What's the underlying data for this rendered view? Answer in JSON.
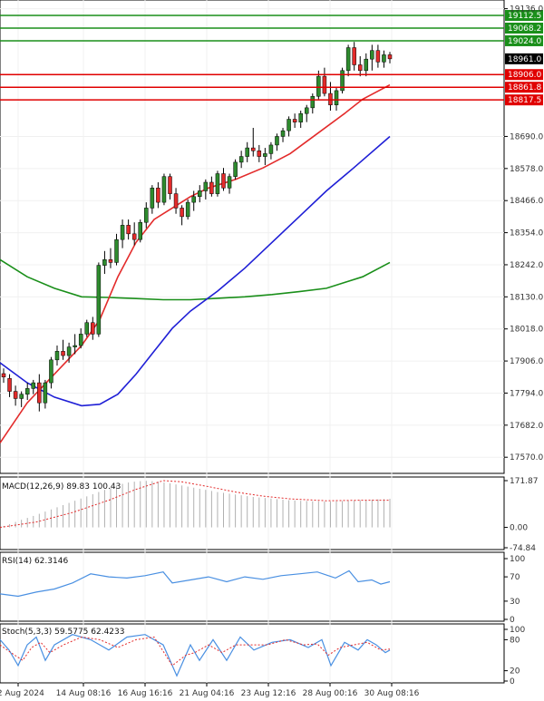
{
  "chart_data": {
    "type": "candlestick",
    "main": {
      "ylim": [
        17520,
        19160
      ],
      "y_ticks": [
        "19136.0",
        "18690.0",
        "18578.0",
        "18466.0",
        "18354.0",
        "18242.0",
        "18130.0",
        "18018.0",
        "17906.0",
        "17794.0",
        "17682.0",
        "17570.0"
      ],
      "current_price": "18961.0",
      "resistance": [
        "19112.5",
        "19068.2",
        "19024.0"
      ],
      "support": [
        "18906.0",
        "18861.8",
        "18817.5"
      ],
      "colors": {
        "up": "#2e8b2e",
        "down": "#e32b2b",
        "resistance": "#1a8f1a",
        "support": "#e00000",
        "ma_fast": "#e32b2b",
        "ma_mid": "#1f1fd6",
        "ma_slow": "#1a8f1a",
        "current": "#000000"
      },
      "candles": [
        {
          "o": 17862,
          "h": 17880,
          "l": 17830,
          "c": 17850
        },
        {
          "o": 17845,
          "h": 17860,
          "l": 17780,
          "c": 17800
        },
        {
          "o": 17800,
          "h": 17820,
          "l": 17750,
          "c": 17775
        },
        {
          "o": 17775,
          "h": 17800,
          "l": 17745,
          "c": 17790
        },
        {
          "o": 17790,
          "h": 17830,
          "l": 17770,
          "c": 17810
        },
        {
          "o": 17810,
          "h": 17840,
          "l": 17790,
          "c": 17830
        },
        {
          "o": 17830,
          "h": 17860,
          "l": 17730,
          "c": 17760
        },
        {
          "o": 17760,
          "h": 17840,
          "l": 17740,
          "c": 17830
        },
        {
          "o": 17830,
          "h": 17920,
          "l": 17810,
          "c": 17910
        },
        {
          "o": 17910,
          "h": 17960,
          "l": 17890,
          "c": 17940
        },
        {
          "o": 17940,
          "h": 17980,
          "l": 17910,
          "c": 17925
        },
        {
          "o": 17925,
          "h": 17970,
          "l": 17900,
          "c": 17955
        },
        {
          "o": 17955,
          "h": 18000,
          "l": 17930,
          "c": 17960
        },
        {
          "o": 17960,
          "h": 18020,
          "l": 17950,
          "c": 18000
        },
        {
          "o": 18000,
          "h": 18050,
          "l": 17990,
          "c": 18040
        },
        {
          "o": 18040,
          "h": 18060,
          "l": 17980,
          "c": 18000
        },
        {
          "o": 18000,
          "h": 18250,
          "l": 17990,
          "c": 18240
        },
        {
          "o": 18240,
          "h": 18290,
          "l": 18210,
          "c": 18260
        },
        {
          "o": 18260,
          "h": 18300,
          "l": 18230,
          "c": 18250
        },
        {
          "o": 18250,
          "h": 18350,
          "l": 18240,
          "c": 18330
        },
        {
          "o": 18330,
          "h": 18400,
          "l": 18300,
          "c": 18380
        },
        {
          "o": 18380,
          "h": 18400,
          "l": 18330,
          "c": 18350
        },
        {
          "o": 18350,
          "h": 18390,
          "l": 18310,
          "c": 18330
        },
        {
          "o": 18330,
          "h": 18400,
          "l": 18320,
          "c": 18390
        },
        {
          "o": 18390,
          "h": 18460,
          "l": 18370,
          "c": 18440
        },
        {
          "o": 18440,
          "h": 18520,
          "l": 18420,
          "c": 18510
        },
        {
          "o": 18510,
          "h": 18530,
          "l": 18440,
          "c": 18460
        },
        {
          "o": 18460,
          "h": 18560,
          "l": 18450,
          "c": 18550
        },
        {
          "o": 18550,
          "h": 18560,
          "l": 18470,
          "c": 18490
        },
        {
          "o": 18490,
          "h": 18510,
          "l": 18420,
          "c": 18440
        },
        {
          "o": 18440,
          "h": 18450,
          "l": 18380,
          "c": 18410
        },
        {
          "o": 18410,
          "h": 18470,
          "l": 18400,
          "c": 18460
        },
        {
          "o": 18460,
          "h": 18500,
          "l": 18430,
          "c": 18480
        },
        {
          "o": 18480,
          "h": 18520,
          "l": 18460,
          "c": 18500
        },
        {
          "o": 18500,
          "h": 18540,
          "l": 18470,
          "c": 18530
        },
        {
          "o": 18530,
          "h": 18550,
          "l": 18480,
          "c": 18490
        },
        {
          "o": 18490,
          "h": 18570,
          "l": 18480,
          "c": 18560
        },
        {
          "o": 18560,
          "h": 18580,
          "l": 18500,
          "c": 18510
        },
        {
          "o": 18510,
          "h": 18560,
          "l": 18490,
          "c": 18550
        },
        {
          "o": 18550,
          "h": 18610,
          "l": 18540,
          "c": 18600
        },
        {
          "o": 18600,
          "h": 18640,
          "l": 18580,
          "c": 18620
        },
        {
          "o": 18620,
          "h": 18670,
          "l": 18600,
          "c": 18650
        },
        {
          "o": 18650,
          "h": 18720,
          "l": 18620,
          "c": 18640
        },
        {
          "o": 18640,
          "h": 18660,
          "l": 18600,
          "c": 18620
        },
        {
          "o": 18620,
          "h": 18650,
          "l": 18590,
          "c": 18630
        },
        {
          "o": 18630,
          "h": 18670,
          "l": 18610,
          "c": 18660
        },
        {
          "o": 18660,
          "h": 18700,
          "l": 18640,
          "c": 18690
        },
        {
          "o": 18690,
          "h": 18720,
          "l": 18670,
          "c": 18710
        },
        {
          "o": 18710,
          "h": 18760,
          "l": 18690,
          "c": 18750
        },
        {
          "o": 18750,
          "h": 18770,
          "l": 18720,
          "c": 18740
        },
        {
          "o": 18740,
          "h": 18780,
          "l": 18720,
          "c": 18770
        },
        {
          "o": 18770,
          "h": 18800,
          "l": 18740,
          "c": 18790
        },
        {
          "o": 18790,
          "h": 18840,
          "l": 18770,
          "c": 18830
        },
        {
          "o": 18830,
          "h": 18920,
          "l": 18820,
          "c": 18900
        },
        {
          "o": 18900,
          "h": 18930,
          "l": 18830,
          "c": 18840
        },
        {
          "o": 18840,
          "h": 18880,
          "l": 18780,
          "c": 18800
        },
        {
          "o": 18800,
          "h": 18860,
          "l": 18780,
          "c": 18850
        },
        {
          "o": 18850,
          "h": 18930,
          "l": 18840,
          "c": 18920
        },
        {
          "o": 18920,
          "h": 19010,
          "l": 18900,
          "c": 19000
        },
        {
          "o": 19000,
          "h": 19020,
          "l": 18920,
          "c": 18940
        },
        {
          "o": 18940,
          "h": 18970,
          "l": 18900,
          "c": 18920
        },
        {
          "o": 18920,
          "h": 18980,
          "l": 18900,
          "c": 18960
        },
        {
          "o": 18960,
          "h": 19010,
          "l": 18920,
          "c": 18990
        },
        {
          "o": 18990,
          "h": 19010,
          "l": 18930,
          "c": 18950
        },
        {
          "o": 18950,
          "h": 18990,
          "l": 18930,
          "c": 18975
        },
        {
          "o": 18975,
          "h": 18985,
          "l": 18945,
          "c": 18961
        }
      ],
      "ma_fast": [
        [
          0,
          17620
        ],
        [
          30,
          17760
        ],
        [
          60,
          17860
        ],
        [
          90,
          17960
        ],
        [
          110,
          18050
        ],
        [
          130,
          18200
        ],
        [
          150,
          18320
        ],
        [
          170,
          18400
        ],
        [
          190,
          18440
        ],
        [
          210,
          18480
        ],
        [
          230,
          18510
        ],
        [
          260,
          18540
        ],
        [
          290,
          18580
        ],
        [
          320,
          18630
        ],
        [
          350,
          18700
        ],
        [
          380,
          18770
        ],
        [
          400,
          18820
        ],
        [
          430,
          18870
        ]
      ],
      "ma_mid": [
        [
          0,
          17900
        ],
        [
          30,
          17830
        ],
        [
          60,
          17780
        ],
        [
          90,
          17750
        ],
        [
          110,
          17755
        ],
        [
          130,
          17790
        ],
        [
          150,
          17860
        ],
        [
          170,
          17940
        ],
        [
          190,
          18020
        ],
        [
          210,
          18080
        ],
        [
          240,
          18150
        ],
        [
          270,
          18230
        ],
        [
          300,
          18320
        ],
        [
          330,
          18410
        ],
        [
          360,
          18500
        ],
        [
          390,
          18580
        ],
        [
          430,
          18690
        ]
      ],
      "ma_slow": [
        [
          0,
          18260
        ],
        [
          30,
          18200
        ],
        [
          60,
          18160
        ],
        [
          90,
          18130
        ],
        [
          120,
          18128
        ],
        [
          150,
          18124
        ],
        [
          180,
          18120
        ],
        [
          210,
          18120
        ],
        [
          240,
          18125
        ],
        [
          270,
          18130
        ],
        [
          300,
          18138
        ],
        [
          330,
          18148
        ],
        [
          360,
          18160
        ],
        [
          380,
          18180
        ],
        [
          400,
          18200
        ],
        [
          430,
          18250
        ]
      ]
    },
    "x_labels": [
      "12 Aug 2024",
      "14 Aug 08:16",
      "16 Aug 16:16",
      "21 Aug 04:16",
      "23 Aug 12:16",
      "28 Aug 00:16",
      "30 Aug 08:16"
    ],
    "macd": {
      "label": "MACD(12,26,9) 89.83 100.43",
      "ylim": [
        -74.84,
        171.87
      ],
      "y_ticks": [
        "171.87",
        "0.00",
        "-74.84"
      ],
      "histogram_color": "#b0b0b0",
      "signal_color": "#e32b2b",
      "histogram": [
        5,
        12,
        20,
        28,
        35,
        42,
        50,
        58,
        66,
        74,
        82,
        90,
        98,
        106,
        114,
        122,
        130,
        138,
        146,
        154,
        160,
        165,
        168,
        170,
        171,
        170,
        168,
        165,
        162,
        158,
        154,
        150,
        146,
        142,
        138,
        134,
        130,
        127,
        124,
        121,
        118,
        115,
        112,
        110,
        108,
        106,
        104,
        102,
        100,
        99,
        98,
        97,
        96,
        96,
        95,
        95,
        96,
        97,
        98,
        99,
        100,
        101,
        102,
        103,
        104,
        105
      ],
      "signal": [
        [
          0,
          0
        ],
        [
          40,
          20
        ],
        [
          80,
          55
        ],
        [
          120,
          100
        ],
        [
          150,
          140
        ],
        [
          180,
          172
        ],
        [
          200,
          168
        ],
        [
          230,
          150
        ],
        [
          260,
          130
        ],
        [
          290,
          115
        ],
        [
          320,
          105
        ],
        [
          360,
          98
        ],
        [
          400,
          100
        ],
        [
          430,
          100
        ]
      ]
    },
    "rsi": {
      "label": "RSI(14) 62.3146",
      "ylim": [
        0,
        100
      ],
      "y_ticks": [
        "100",
        "70",
        "30",
        "0"
      ],
      "color": "#4a90e2",
      "values": [
        [
          0,
          42
        ],
        [
          20,
          38
        ],
        [
          40,
          45
        ],
        [
          60,
          50
        ],
        [
          80,
          60
        ],
        [
          100,
          75
        ],
        [
          120,
          70
        ],
        [
          140,
          68
        ],
        [
          160,
          72
        ],
        [
          180,
          78
        ],
        [
          190,
          60
        ],
        [
          210,
          65
        ],
        [
          230,
          70
        ],
        [
          250,
          62
        ],
        [
          270,
          70
        ],
        [
          290,
          66
        ],
        [
          310,
          72
        ],
        [
          330,
          75
        ],
        [
          350,
          78
        ],
        [
          370,
          68
        ],
        [
          385,
          80
        ],
        [
          395,
          62
        ],
        [
          410,
          65
        ],
        [
          420,
          58
        ],
        [
          430,
          62
        ]
      ]
    },
    "stoch": {
      "label": "Stoch(5,3,3) 59.5775 62.4233",
      "ylim": [
        0,
        100
      ],
      "y_ticks": [
        "100",
        "80",
        "20",
        "0"
      ],
      "k_color": "#4a90e2",
      "d_color": "#e32b2b",
      "k": [
        [
          0,
          80
        ],
        [
          10,
          60
        ],
        [
          20,
          30
        ],
        [
          30,
          70
        ],
        [
          40,
          85
        ],
        [
          50,
          40
        ],
        [
          60,
          70
        ],
        [
          80,
          90
        ],
        [
          100,
          80
        ],
        [
          120,
          60
        ],
        [
          140,
          85
        ],
        [
          160,
          90
        ],
        [
          180,
          70
        ],
        [
          195,
          10
        ],
        [
          210,
          70
        ],
        [
          220,
          40
        ],
        [
          235,
          80
        ],
        [
          250,
          40
        ],
        [
          265,
          85
        ],
        [
          280,
          60
        ],
        [
          300,
          75
        ],
        [
          320,
          80
        ],
        [
          340,
          65
        ],
        [
          355,
          80
        ],
        [
          365,
          30
        ],
        [
          380,
          75
        ],
        [
          395,
          60
        ],
        [
          405,
          80
        ],
        [
          415,
          70
        ],
        [
          425,
          55
        ],
        [
          430,
          60
        ]
      ],
      "d": [
        [
          0,
          70
        ],
        [
          12,
          55
        ],
        [
          25,
          40
        ],
        [
          35,
          65
        ],
        [
          45,
          75
        ],
        [
          55,
          55
        ],
        [
          70,
          70
        ],
        [
          90,
          85
        ],
        [
          110,
          80
        ],
        [
          130,
          65
        ],
        [
          150,
          80
        ],
        [
          170,
          85
        ],
        [
          190,
          30
        ],
        [
          205,
          50
        ],
        [
          215,
          55
        ],
        [
          230,
          70
        ],
        [
          245,
          55
        ],
        [
          260,
          70
        ],
        [
          275,
          70
        ],
        [
          295,
          70
        ],
        [
          315,
          80
        ],
        [
          335,
          70
        ],
        [
          350,
          72
        ],
        [
          362,
          50
        ],
        [
          375,
          65
        ],
        [
          390,
          70
        ],
        [
          405,
          75
        ],
        [
          420,
          60
        ],
        [
          430,
          62
        ]
      ]
    }
  }
}
